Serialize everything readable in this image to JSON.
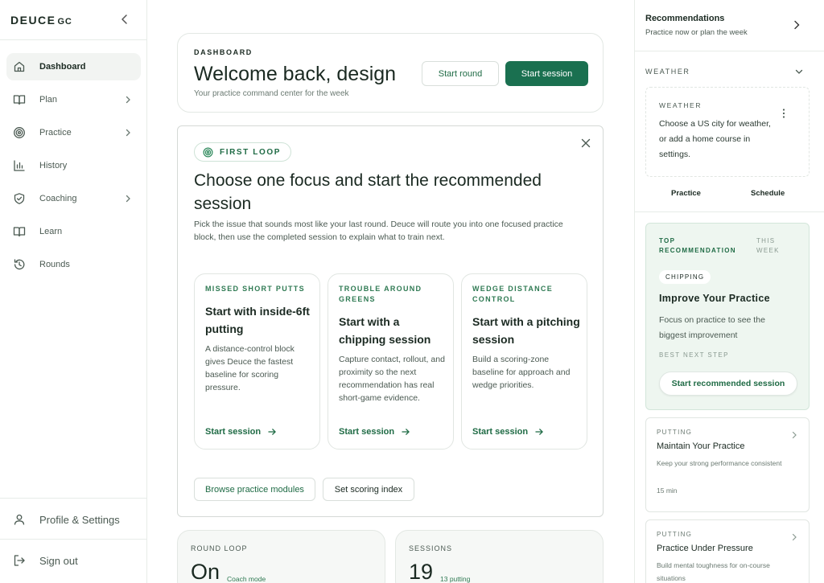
{
  "brand": {
    "name": "DEUCE",
    "suffix": "GC"
  },
  "sidebar": {
    "items": [
      {
        "label": "Dashboard",
        "icon": "home-icon",
        "active": true,
        "has_children": false
      },
      {
        "label": "Plan",
        "icon": "book-open-icon",
        "active": false,
        "has_children": true
      },
      {
        "label": "Practice",
        "icon": "target-icon",
        "active": false,
        "has_children": true
      },
      {
        "label": "History",
        "icon": "bar-chart-icon",
        "active": false,
        "has_children": false
      },
      {
        "label": "Coaching",
        "icon": "shield-check-icon",
        "active": false,
        "has_children": true
      },
      {
        "label": "Learn",
        "icon": "book-icon",
        "active": false,
        "has_children": false
      },
      {
        "label": "Rounds",
        "icon": "history-icon",
        "active": false,
        "has_children": false
      }
    ],
    "profile_label": "Profile & Settings",
    "signout_label": "Sign out"
  },
  "hero": {
    "eyebrow": "DASHBOARD",
    "title": "Welcome back, design",
    "subtitle": "Your practice command center for the week",
    "start_round_label": "Start round",
    "start_session_label": "Start session"
  },
  "first_loop": {
    "pill": "FIRST LOOP",
    "title": "Choose one focus and start the recommended session",
    "description": "Pick the issue that sounds most like your last round. Deuce will route you into one focused practice block, then use the completed session to explain what to train next.",
    "options": [
      {
        "tag": "MISSED SHORT PUTTS",
        "title": "Start with inside-6ft putting",
        "description": "A distance-control block gives Deuce the fastest baseline for scoring pressure.",
        "cta": "Start session"
      },
      {
        "tag": "TROUBLE AROUND GREENS",
        "title": "Start with a chipping session",
        "description": "Capture contact, rollout, and proximity so the next recommendation has real short-game evidence.",
        "cta": "Start session"
      },
      {
        "tag": "WEDGE DISTANCE CONTROL",
        "title": "Start with a pitching session",
        "description": "Build a scoring-zone baseline for approach and wedge priorities.",
        "cta": "Start session"
      }
    ],
    "browse_label": "Browse practice modules",
    "scoring_label": "Set scoring index"
  },
  "stats": [
    {
      "label": "ROUND LOOP",
      "value": "On",
      "note": "Coach mode"
    },
    {
      "label": "SESSIONS",
      "value": "19",
      "note": "13 putting"
    }
  ],
  "recommendations": {
    "title": "Recommendations",
    "subtitle": "Practice now or plan the week",
    "weather_header": "WEATHER",
    "weather_card": {
      "eyebrow": "WEATHER",
      "text": "Choose a US city for weather, or add a home course in settings."
    },
    "tabs": [
      "Practice",
      "Schedule"
    ],
    "top": {
      "tag": "TOP RECOMMENDATION",
      "week": "THIS WEEK",
      "chip": "CHIPPING",
      "title": "Improve Your Practice",
      "description": "Focus on practice to see the biggest improvement",
      "best_next": "BEST NEXT STEP",
      "button": "Start recommended session"
    },
    "items": [
      {
        "tag": "PUTTING",
        "title": "Maintain Your Practice",
        "description": "Keep your strong performance consistent",
        "meta": "15 min"
      },
      {
        "tag": "PUTTING",
        "title": "Practice Under Pressure",
        "description": "Build mental toughness for on-course situations",
        "meta": ""
      }
    ]
  },
  "colors": {
    "accent": "#1a7050",
    "accent_text": "#1f6b45",
    "recommendation_bg": "#eef6f0",
    "stat_bg": "#f6f8f6"
  }
}
